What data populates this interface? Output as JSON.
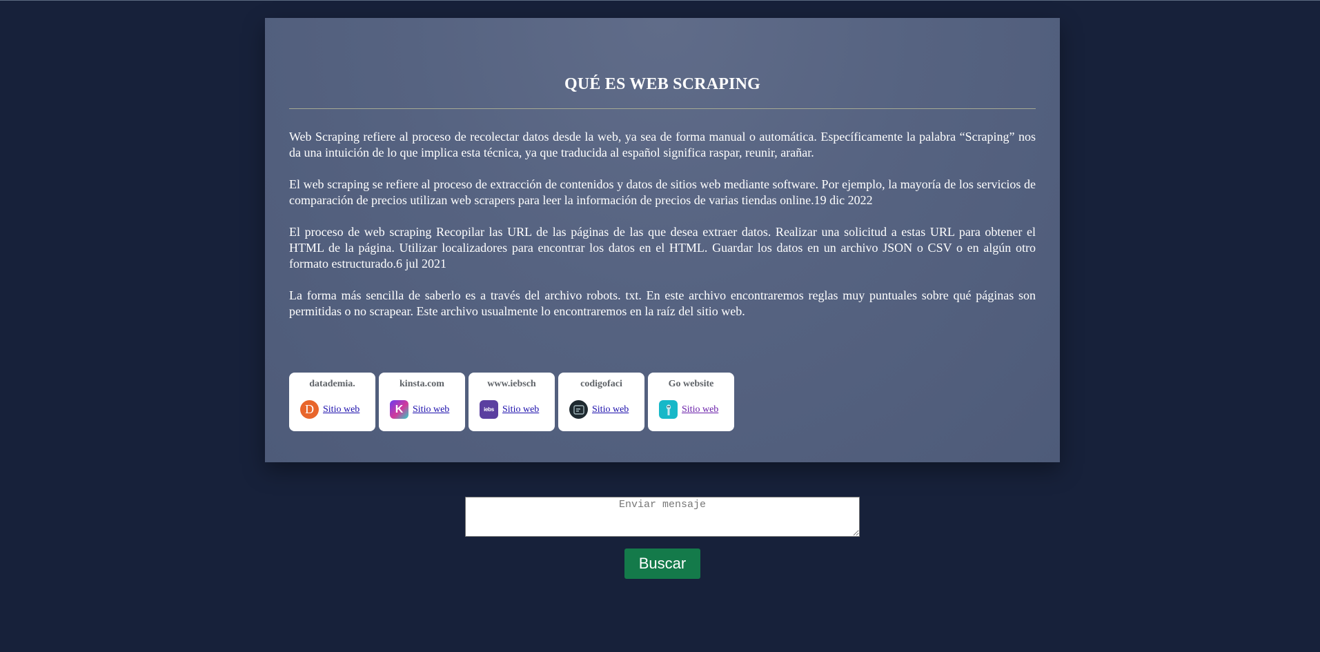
{
  "article": {
    "title": "QUÉ ES WEB SCRAPING",
    "paragraphs": [
      "Web Scraping refiere al proceso de recolectar datos desde la web, ya sea de forma manual o automática. Específicamente la palabra “Scraping” nos da una intuición de lo que implica esta técnica, ya que traducida al español significa raspar, reunir, arañar.",
      "El web scraping se refiere al proceso de extracción de contenidos y datos de sitios web mediante software. Por ejemplo, la mayoría de los servicios de comparación de precios utilizan web scrapers para leer la información de precios de varias tiendas online.19 dic 2022",
      "El proceso de web scraping Recopilar las URL de las páginas de las que desea extraer datos. Realizar una solicitud a estas URL para obtener el HTML de la página. Utilizar localizadores para encontrar los datos en el HTML. Guardar los datos en un archivo JSON o CSV o en algún otro formato estructurado.6 jul 2021",
      "La forma más sencilla de saberlo es a través del archivo robots. txt. En este archivo encontraremos reglas muy puntuales sobre qué páginas son permitidas o no scrapear. Este archivo usualmente lo encontraremos en la raíz del sitio web."
    ]
  },
  "sources": [
    {
      "name": "datademia.",
      "link_label": "Sitio web",
      "icon": "datademia-favicon-icon",
      "icon_letter": "D",
      "color": "#e8662c"
    },
    {
      "name": "kinsta.com",
      "link_label": "Sitio web",
      "icon": "kinsta-favicon-icon",
      "icon_letter": "K",
      "color": "#8e44ec"
    },
    {
      "name": "www.iebsch",
      "link_label": "Sitio web",
      "icon": "iebs-favicon-icon",
      "icon_letter": "iebs",
      "color": "#5b3fa0"
    },
    {
      "name": "codigofaci",
      "link_label": "Sitio web",
      "icon": "codigofacilito-favicon-icon",
      "icon_letter": "",
      "color": "#1f2a30"
    },
    {
      "name": "Go website",
      "link_label": "Sitio web",
      "icon": "go-website-favicon-icon",
      "icon_letter": "",
      "color": "#17b8c8"
    }
  ],
  "form": {
    "message_placeholder": "Enviar mensaje",
    "search_label": "Buscar"
  },
  "colors": {
    "background": "#17213a",
    "card": "#566381",
    "button": "#147a4a",
    "link": "#1a0dab"
  }
}
